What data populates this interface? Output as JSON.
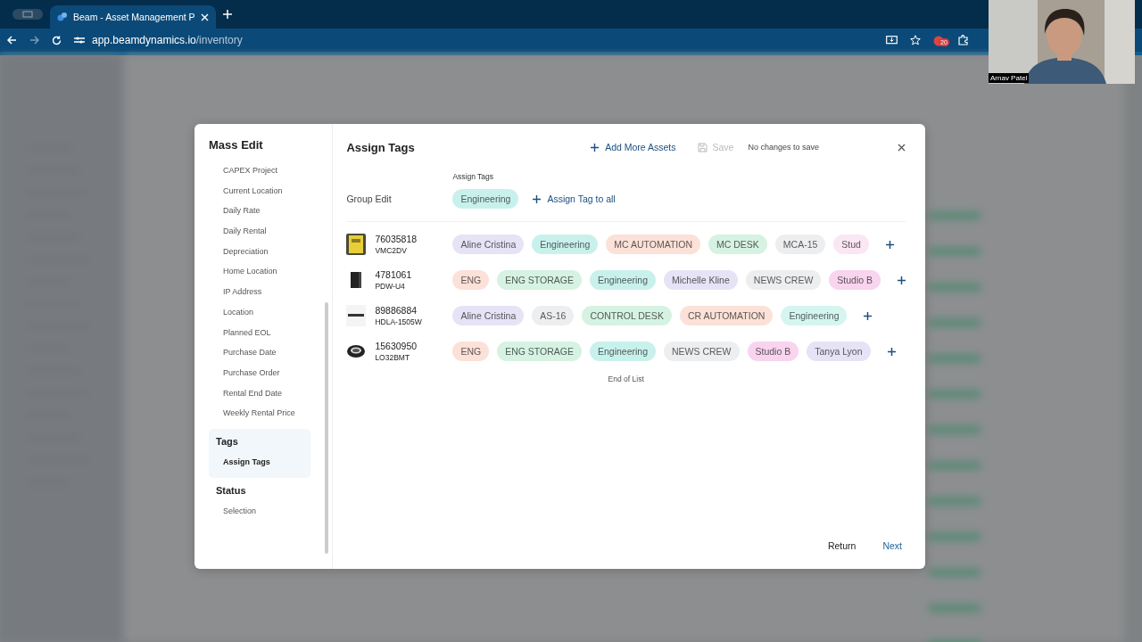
{
  "browser": {
    "tab_title": "Beam - Asset Management P",
    "url_host": "app.beamdynamics.io",
    "url_path": "/inventory",
    "extension_badge": "20"
  },
  "webcam": {
    "caption": "Arnav Patel"
  },
  "modal": {
    "title": "Mass Edit",
    "groups": [
      {
        "items": [
          {
            "label": "CAPEX Project",
            "selected": false
          },
          {
            "label": "Current Location",
            "selected": false
          },
          {
            "label": "Daily Rate",
            "selected": false
          },
          {
            "label": "Daily Rental",
            "selected": false
          },
          {
            "label": "Depreciation",
            "selected": false
          },
          {
            "label": "Home Location",
            "selected": false
          },
          {
            "label": "IP Address",
            "selected": false
          },
          {
            "label": "Location",
            "selected": false
          },
          {
            "label": "Planned EOL",
            "selected": false
          },
          {
            "label": "Purchase Date",
            "selected": false
          },
          {
            "label": "Purchase Order",
            "selected": false
          },
          {
            "label": "Rental End Date",
            "selected": false
          },
          {
            "label": "Weekly Rental Price",
            "selected": false
          }
        ]
      },
      {
        "heading": "Tags",
        "items": [
          {
            "label": "Assign Tags",
            "selected": true
          }
        ]
      },
      {
        "heading": "Status",
        "items": [
          {
            "label": "Selection",
            "selected": false
          }
        ]
      }
    ],
    "panel_title": "Assign Tags",
    "add_assets": "Add More Assets",
    "save": {
      "label": "Save",
      "disabled": true
    },
    "save_status": "No changes to save",
    "group_edit": {
      "label": "Group Edit",
      "column_label": "Assign Tags",
      "tags": [
        {
          "label": "Engineering",
          "color": "#c9f1ec"
        }
      ],
      "assign_all": "Assign Tag to all"
    },
    "assets": [
      {
        "number": "76035818",
        "model": "VMC2DV",
        "tags": [
          {
            "label": "Aline Cristina",
            "color": "#e7e3f6"
          },
          {
            "label": "Engineering",
            "color": "#c9f1ec"
          },
          {
            "label": "MC AUTOMATION",
            "color": "#fbe1d7"
          },
          {
            "label": "MC DESK",
            "color": "#d6f2e2"
          },
          {
            "label": "MCA-15",
            "color": "#eceef0"
          },
          {
            "label": "Stud",
            "color": "#fbe6f3"
          }
        ]
      },
      {
        "number": "4781061",
        "model": "PDW-U4",
        "tags": [
          {
            "label": "ENG",
            "color": "#fbe1d7"
          },
          {
            "label": "ENG STORAGE",
            "color": "#d6f2e2"
          },
          {
            "label": "Engineering",
            "color": "#c9f1ec"
          },
          {
            "label": "Michelle Kline",
            "color": "#e7e3f6"
          },
          {
            "label": "NEWS CREW",
            "color": "#eceef0"
          },
          {
            "label": "Studio B",
            "color": "#f8d4ee"
          }
        ]
      },
      {
        "number": "89886884",
        "model": "HDLA-1505W",
        "tags": [
          {
            "label": "Aline Cristina",
            "color": "#e7e3f6"
          },
          {
            "label": "AS-16",
            "color": "#eceef0"
          },
          {
            "label": "CONTROL DESK",
            "color": "#d6f2e2"
          },
          {
            "label": "CR AUTOMATION",
            "color": "#fbe1d7"
          },
          {
            "label": "Engineering",
            "color": "#d5f5f0"
          }
        ]
      },
      {
        "number": "15630950",
        "model": "LO32BMT",
        "tags": [
          {
            "label": "ENG",
            "color": "#fbe1d7"
          },
          {
            "label": "ENG STORAGE",
            "color": "#d6f2e2"
          },
          {
            "label": "Engineering",
            "color": "#c9f1ec"
          },
          {
            "label": "NEWS CREW",
            "color": "#eceef0"
          },
          {
            "label": "Studio B",
            "color": "#f8d4ee"
          },
          {
            "label": "Tanya Lyon",
            "color": "#e7e3f6"
          }
        ]
      }
    ],
    "end_text": "End of List",
    "return_label": "Return",
    "next_label": "Next"
  }
}
